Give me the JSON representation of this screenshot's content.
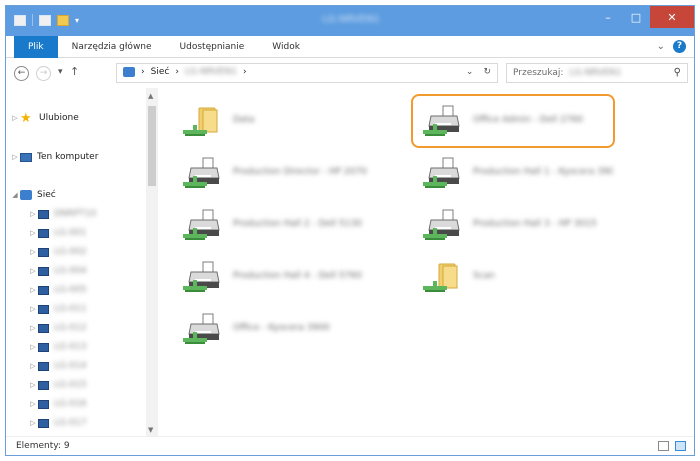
{
  "window": {
    "title": "LG-NRVEN1",
    "controls": {
      "minimize": "–",
      "maximize": "□",
      "close": "✕"
    }
  },
  "quick_access": {
    "dropdown": "▾"
  },
  "ribbon": {
    "tabs": [
      "Plik",
      "Narzędzia główne",
      "Udostępnianie",
      "Widok"
    ],
    "expand": "⌄",
    "help": "?"
  },
  "address": {
    "back": "←",
    "forward": "→",
    "recent": "▾",
    "up": "↑",
    "breadcrumb": [
      "Sieć",
      "LG-NRVEN1"
    ],
    "breadcrumb_sep": "›",
    "dropdown": "⌄",
    "refresh": "↻"
  },
  "search": {
    "placeholder": "Przeszukaj:",
    "target": "LG-NRVEN1",
    "icon": "search-icon"
  },
  "nav": {
    "favorites": "Ulubione",
    "computer": "Ten komputer",
    "network": "Sieć",
    "network_children": [
      "DNRPT10",
      "LG-001",
      "LG-002",
      "LG-004",
      "LG-005",
      "LG-011",
      "LG-012",
      "LG-013",
      "LG-014",
      "LG-015",
      "LG-016",
      "LG-017"
    ]
  },
  "items": [
    {
      "name": "Data",
      "type": "folder",
      "highlighted": false
    },
    {
      "name": "Office Admin - Dell 2760",
      "type": "printer",
      "highlighted": true
    },
    {
      "name": "Production Director - HP 2070",
      "type": "printer",
      "highlighted": false
    },
    {
      "name": "Production Hall 1 - Kyocera 3900",
      "type": "printer",
      "highlighted": false
    },
    {
      "name": "Production Hall 2 - Dell 5130",
      "type": "printer",
      "highlighted": false
    },
    {
      "name": "Production Hall 3 - HP 3015",
      "type": "printer",
      "highlighted": false
    },
    {
      "name": "Production Hall 4 - Dell 5760",
      "type": "printer",
      "highlighted": false
    },
    {
      "name": "Scan",
      "type": "folder",
      "highlighted": false
    },
    {
      "name": "Office - Kyocera 3900",
      "type": "printer",
      "highlighted": false
    }
  ],
  "status": {
    "count_label": "Elementy: 9"
  },
  "colors": {
    "titlebar": "#5d9ce0",
    "file_tab": "#1979ca",
    "highlight": "#f29a2e",
    "close": "#c7463a"
  }
}
